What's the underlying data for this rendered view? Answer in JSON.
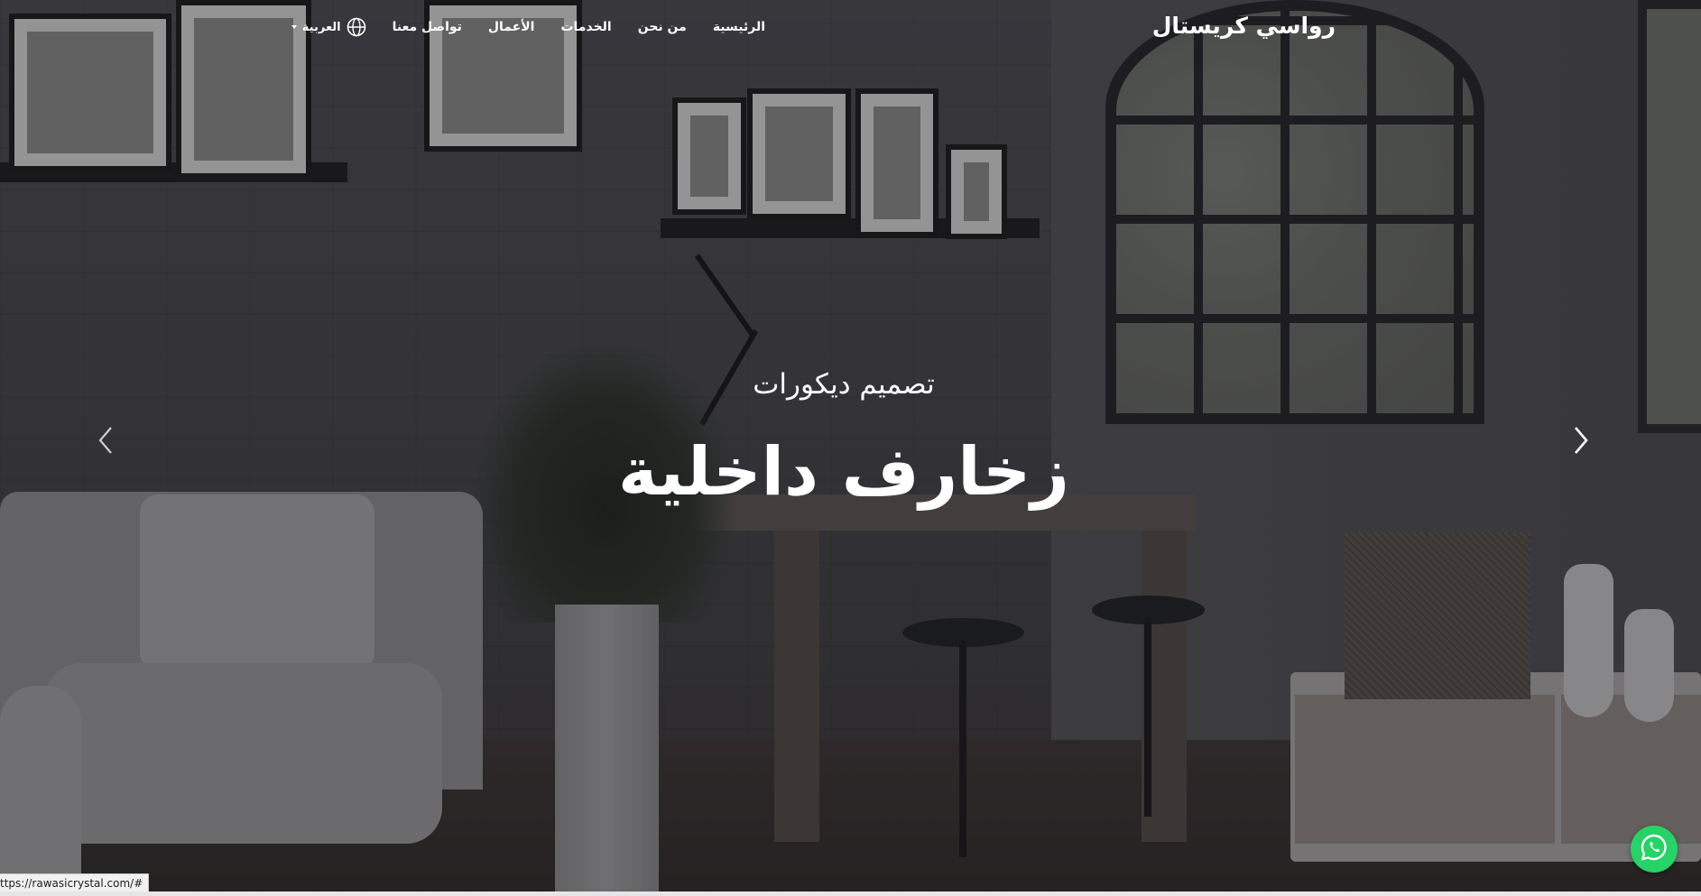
{
  "nav": {
    "brand": "رواسي كريستال",
    "items": [
      {
        "label": "الرئيسية"
      },
      {
        "label": "من نحن"
      },
      {
        "label": "الخدمات"
      },
      {
        "label": "الأعمال"
      },
      {
        "label": "تواصل معنا"
      }
    ],
    "language": {
      "label": "العربية",
      "icon": "globe-icon"
    }
  },
  "hero": {
    "subtitle": "تصميم ديكورات",
    "title": "زخارف داخلية"
  },
  "carousel": {
    "prev_icon": "chevron-left-icon",
    "next_icon": "chevron-right-icon"
  },
  "whatsapp": {
    "icon": "whatsapp-icon",
    "color": "#25d366"
  },
  "status_bar": {
    "url": "ttps://rawasicrystal.com/#"
  }
}
